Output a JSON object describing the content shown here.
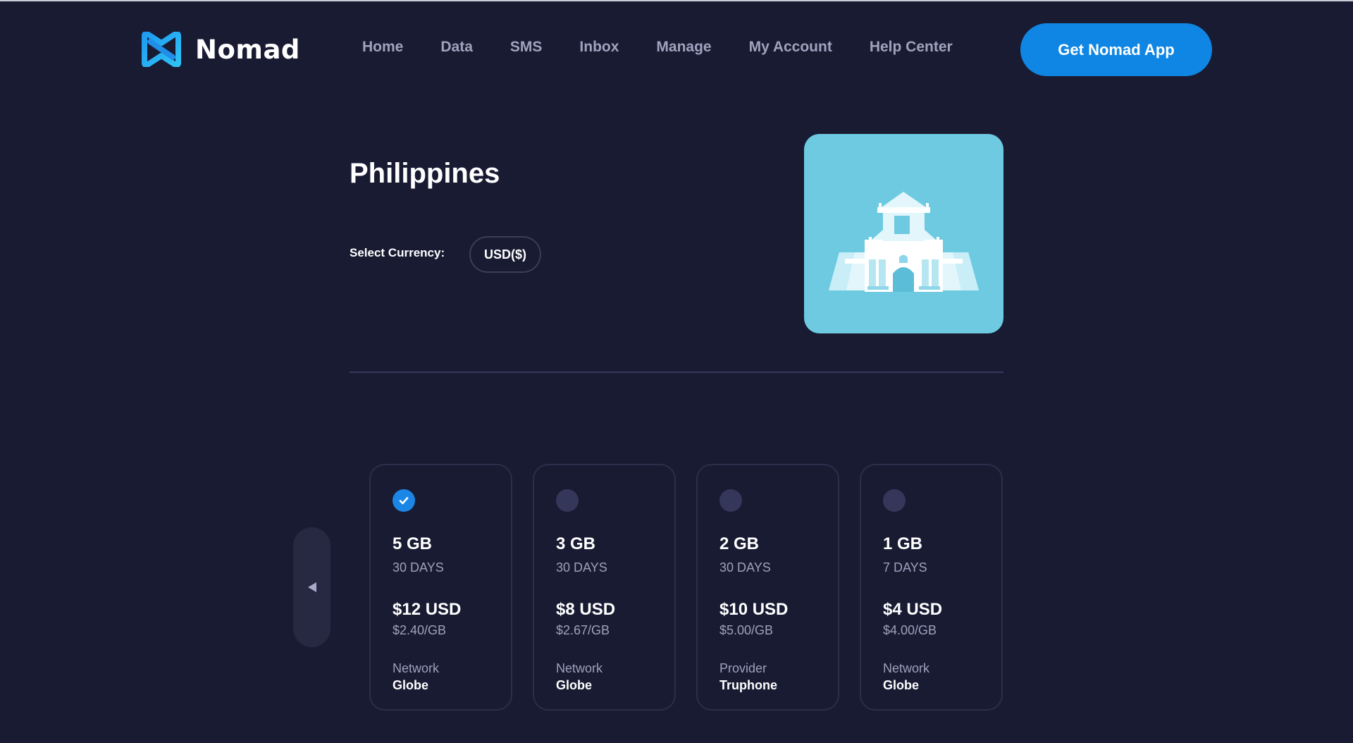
{
  "header": {
    "brand": "Nomad",
    "nav": [
      {
        "label": "Home"
      },
      {
        "label": "Data"
      },
      {
        "label": "SMS"
      },
      {
        "label": "Inbox"
      },
      {
        "label": "Manage"
      },
      {
        "label": "My Account"
      },
      {
        "label": "Help Center"
      }
    ],
    "cta_label": "Get Nomad App"
  },
  "country": {
    "name": "Philippines",
    "currency_label": "Select Currency:",
    "currency_value": "USD($)",
    "image_icon": "fort-gate-landmark-icon"
  },
  "plans": {
    "prev_icon": "triangle-left-icon",
    "items": [
      {
        "data": "5 GB",
        "duration": "30 DAYS",
        "price": "$12 USD",
        "per_gb": "$2.40/GB",
        "carrier_label": "Network",
        "carrier": "Globe",
        "selected": true
      },
      {
        "data": "3 GB",
        "duration": "30 DAYS",
        "price": "$8 USD",
        "per_gb": "$2.67/GB",
        "carrier_label": "Network",
        "carrier": "Globe",
        "selected": false
      },
      {
        "data": "2 GB",
        "duration": "30 DAYS",
        "price": "$10 USD",
        "per_gb": "$5.00/GB",
        "carrier_label": "Provider",
        "carrier": "Truphone",
        "selected": false
      },
      {
        "data": "1 GB",
        "duration": "7 DAYS",
        "price": "$4 USD",
        "per_gb": "$4.00/GB",
        "carrier_label": "Network",
        "carrier": "Globe",
        "selected": false
      }
    ]
  },
  "colors": {
    "background": "#191b33",
    "accent": "#0f86e3",
    "nav_text": "#9fa3bd",
    "image_bg": "#6dcae0"
  }
}
